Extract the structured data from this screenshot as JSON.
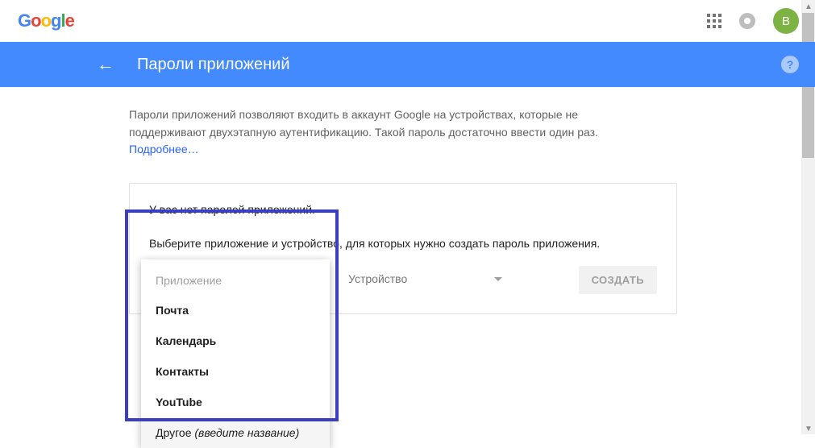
{
  "header": {
    "logo_text": "Google",
    "avatar_initial": "B"
  },
  "bluebar": {
    "title": "Пароли приложений"
  },
  "help_symbol": "?",
  "description": {
    "line": "Пароли приложений позволяют входить в аккаунт Google на устройствах, которые не поддерживают двухэтапную аутентификацию. Такой пароль достаточно ввести один раз.",
    "learn_more": "Подробнее…"
  },
  "card": {
    "no_passwords": "У вас нет паролей приложений.",
    "select_prompt": "Выберите приложение и устройство, для которых нужно создать пароль приложения.",
    "app_select": {
      "placeholder": "Приложение",
      "options": {
        "mail": "Почта",
        "calendar": "Календарь",
        "contacts": "Контакты",
        "youtube": "YouTube",
        "other_prefix": "Другое ",
        "other_hint": "(введите название)"
      }
    },
    "device_select": {
      "placeholder": "Устройство"
    },
    "create_button": "СОЗДАТЬ"
  }
}
